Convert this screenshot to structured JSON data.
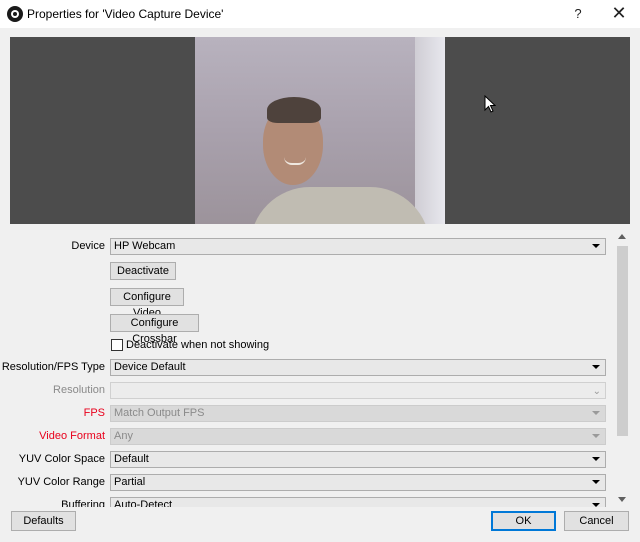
{
  "window": {
    "title": "Properties for 'Video Capture Device'",
    "help_label": "?",
    "close_label": "✕"
  },
  "properties": {
    "device": {
      "label": "Device",
      "value": "HP Webcam"
    },
    "deactivate_button": "Deactivate",
    "configure_video_button": "Configure Video",
    "configure_crossbar_button": "Configure Crossbar",
    "deactivate_when_not_showing": {
      "label": "Deactivate when not showing",
      "checked": false
    },
    "resolution_fps_type": {
      "label": "Resolution/FPS Type",
      "value": "Device Default"
    },
    "resolution": {
      "label": "Resolution",
      "value": ""
    },
    "fps": {
      "label": "FPS",
      "value": "Match Output FPS"
    },
    "video_format": {
      "label": "Video Format",
      "value": "Any"
    },
    "yuv_color_space": {
      "label": "YUV Color Space",
      "value": "Default"
    },
    "yuv_color_range": {
      "label": "YUV Color Range",
      "value": "Partial"
    },
    "buffering": {
      "label": "Buffering",
      "value": "Auto-Detect"
    }
  },
  "footer": {
    "defaults_label": "Defaults",
    "ok_label": "OK",
    "cancel_label": "Cancel"
  },
  "colors": {
    "warning_label": "#e8001c",
    "disabled_text": "#8a8a8a",
    "primary_border": "#0078d7",
    "preview_background": "#4c4c4c"
  },
  "icons": {
    "app": "obs-logo-icon",
    "help": "help-icon",
    "close": "close-icon",
    "cursor": "mouse-cursor-icon",
    "dropdown": "dropdown-arrow-icon",
    "chevron": "chevron-down-icon"
  }
}
